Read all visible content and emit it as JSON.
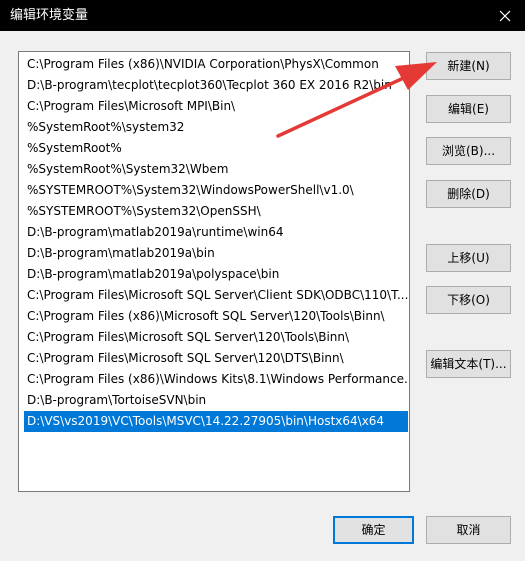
{
  "window": {
    "title": "编辑环境变量",
    "close_glyph": "✕"
  },
  "path_list": {
    "items": [
      {
        "text": "C:\\Program Files (x86)\\NVIDIA Corporation\\PhysX\\Common",
        "selected": false
      },
      {
        "text": "D:\\B-program\\tecplot\\tecplot360\\Tecplot 360 EX 2016 R2\\bin",
        "selected": false
      },
      {
        "text": "C:\\Program Files\\Microsoft MPI\\Bin\\",
        "selected": false
      },
      {
        "text": "%SystemRoot%\\system32",
        "selected": false
      },
      {
        "text": "%SystemRoot%",
        "selected": false
      },
      {
        "text": "%SystemRoot%\\System32\\Wbem",
        "selected": false
      },
      {
        "text": "%SYSTEMROOT%\\System32\\WindowsPowerShell\\v1.0\\",
        "selected": false
      },
      {
        "text": "%SYSTEMROOT%\\System32\\OpenSSH\\",
        "selected": false
      },
      {
        "text": "D:\\B-program\\matlab2019a\\runtime\\win64",
        "selected": false
      },
      {
        "text": "D:\\B-program\\matlab2019a\\bin",
        "selected": false
      },
      {
        "text": "D:\\B-program\\matlab2019a\\polyspace\\bin",
        "selected": false
      },
      {
        "text": "C:\\Program Files\\Microsoft SQL Server\\Client SDK\\ODBC\\110\\T...",
        "selected": false
      },
      {
        "text": "C:\\Program Files (x86)\\Microsoft SQL Server\\120\\Tools\\Binn\\",
        "selected": false
      },
      {
        "text": "C:\\Program Files\\Microsoft SQL Server\\120\\Tools\\Binn\\",
        "selected": false
      },
      {
        "text": "C:\\Program Files\\Microsoft SQL Server\\120\\DTS\\Binn\\",
        "selected": false
      },
      {
        "text": "C:\\Program Files (x86)\\Windows Kits\\8.1\\Windows Performance...",
        "selected": false
      },
      {
        "text": "D:\\B-program\\TortoiseSVN\\bin",
        "selected": false
      },
      {
        "text": "D:\\VS\\vs2019\\VC\\Tools\\MSVC\\14.22.27905\\bin\\Hostx64\\x64",
        "selected": true
      }
    ]
  },
  "buttons": {
    "new": "新建(N)",
    "edit": "编辑(E)",
    "browse": "浏览(B)...",
    "delete": "删除(D)",
    "move_up": "上移(U)",
    "move_down": "下移(O)",
    "edit_text": "编辑文本(T)...",
    "ok": "确定",
    "cancel": "取消"
  },
  "colors": {
    "titlebar_bg": "#000000",
    "selection": "#0078d7",
    "arrow": "#e53935"
  }
}
